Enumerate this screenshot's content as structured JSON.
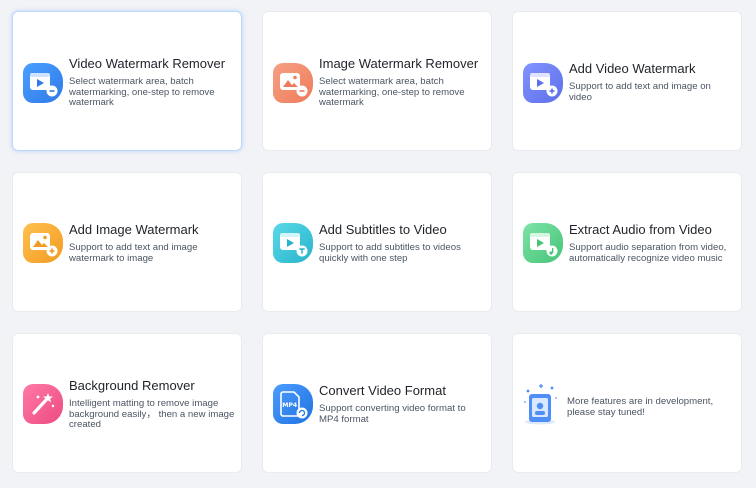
{
  "cards": [
    {
      "title": "Video Watermark Remover",
      "desc": "Select watermark area, batch watermarking, one-step to remove watermark",
      "icon": "video-remove-icon",
      "color": "#3a8cf7",
      "selected": true
    },
    {
      "title": "Image Watermark Remover",
      "desc": "Select watermark area, batch watermarking, one-step to remove watermark",
      "icon": "image-remove-icon",
      "color": "#f28a6b"
    },
    {
      "title": "Add Video Watermark",
      "desc": "Support to add text and image on video",
      "icon": "video-add-icon",
      "color": "#6b7df2"
    },
    {
      "title": "Add Image Watermark",
      "desc": "Support to add text and image watermark to image",
      "icon": "image-add-icon",
      "color": "#f6aa2f"
    },
    {
      "title": "Add Subtitles to Video",
      "desc": "Support to add subtitles to videos quickly with one step",
      "icon": "subtitle-icon",
      "color": "#3cc9da"
    },
    {
      "title": "Extract Audio from Video",
      "desc": "Support audio separation from video, automatically recognize video music",
      "icon": "audio-extract-icon",
      "color": "#5fd68f"
    },
    {
      "title": "Background Remover",
      "desc": "Intelligent matting to remove image background easily， then a new image created",
      "icon": "magic-wand-icon",
      "color": "#f25c8f"
    },
    {
      "title": "Convert Video Format",
      "desc": "Support converting video format to MP4 format",
      "icon": "mp4-convert-icon",
      "color": "#2d86ee",
      "badge": "MP4"
    },
    {
      "title": "",
      "desc": "More features are in development, please stay tuned!",
      "icon": "development-illustration-icon",
      "color": "#4f8ef7"
    }
  ]
}
